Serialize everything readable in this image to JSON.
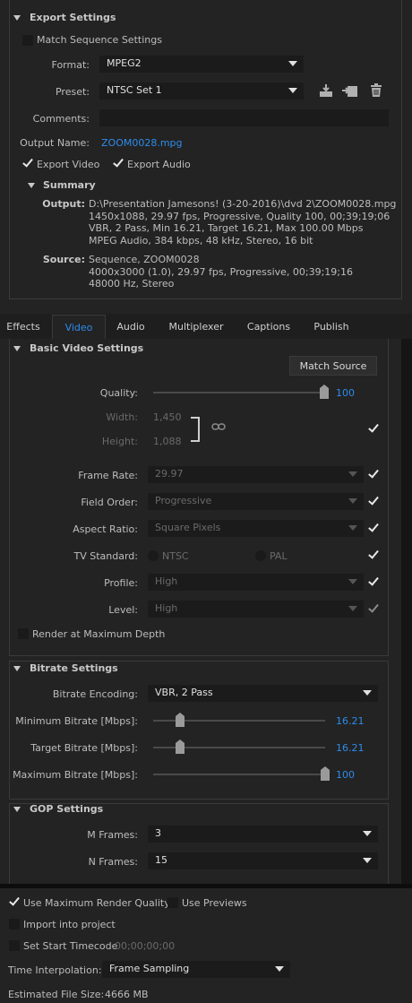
{
  "export_settings": {
    "title": "Export Settings",
    "match_sequence_label": "Match Sequence Settings",
    "format_label": "Format:",
    "format_value": "MPEG2",
    "preset_label": "Preset:",
    "preset_value": "NTSC Set 1",
    "comments_label": "Comments:",
    "comments_value": "",
    "output_name_label": "Output Name:",
    "output_name_value": "ZOOM0028.mpg",
    "export_video_label": "Export Video",
    "export_audio_label": "Export Audio",
    "summary": {
      "title": "Summary",
      "output_label": "Output:",
      "output_lines": [
        "D:\\Presentation Jamesons! (3-20-2016)\\dvd 2\\ZOOM0028.mpg",
        "1450x1088, 29.97 fps, Progressive, Quality 100, 00;39;19;06",
        "VBR, 2 Pass, Min 16.21, Target 16.21, Max 100.00 Mbps",
        "MPEG Audio, 384 kbps, 48 kHz, Stereo, 16 bit"
      ],
      "source_label": "Source:",
      "source_lines": [
        "Sequence, ZOOM0028",
        "4000x3000 (1.0), 29.97 fps, Progressive, 00;39;19;16",
        "48000 Hz, Stereo"
      ]
    }
  },
  "tabs": [
    "Effects",
    "Video",
    "Audio",
    "Multiplexer",
    "Captions",
    "Publish"
  ],
  "basic_video": {
    "title": "Basic Video Settings",
    "match_source_label": "Match Source",
    "quality_label": "Quality:",
    "quality_value": "100",
    "quality_level": 1.0,
    "width_label": "Width:",
    "width_value": "1,450",
    "height_label": "Height:",
    "height_value": "1,088",
    "frame_rate_label": "Frame Rate:",
    "frame_rate_value": "29.97",
    "field_order_label": "Field Order:",
    "field_order_value": "Progressive",
    "aspect_ratio_label": "Aspect Ratio:",
    "aspect_ratio_value": "Square Pixels",
    "tv_standard_label": "TV Standard:",
    "ntsc_label": "NTSC",
    "pal_label": "PAL",
    "profile_label": "Profile:",
    "profile_value": "High",
    "level_label": "Level:",
    "level_value": "High",
    "render_max_depth_label": "Render at Maximum Depth"
  },
  "bitrate": {
    "title": "Bitrate Settings",
    "encoding_label": "Bitrate Encoding:",
    "encoding_value": "VBR, 2 Pass",
    "min_label": "Minimum Bitrate [Mbps]:",
    "min_value": "16.21",
    "target_label": "Target Bitrate [Mbps]:",
    "target_value": "16.21",
    "max_label": "Maximum Bitrate [Mbps]:",
    "max_value": "100"
  },
  "gop": {
    "title": "GOP Settings",
    "m_frames_label": "M Frames:",
    "m_frames_value": "3",
    "n_frames_label": "N Frames:",
    "n_frames_value": "15"
  },
  "bottom": {
    "max_render_quality_label": "Use Maximum Render Quality",
    "use_previews_label": "Use Previews",
    "import_label": "Import into project",
    "start_timecode_label": "Set Start Timecode",
    "start_timecode_value": "00;00;00;00",
    "time_interp_label": "Time Interpolation:",
    "time_interp_value": "Frame Sampling",
    "est_size_label": "Estimated File Size:",
    "est_size_value": "4666 MB"
  }
}
